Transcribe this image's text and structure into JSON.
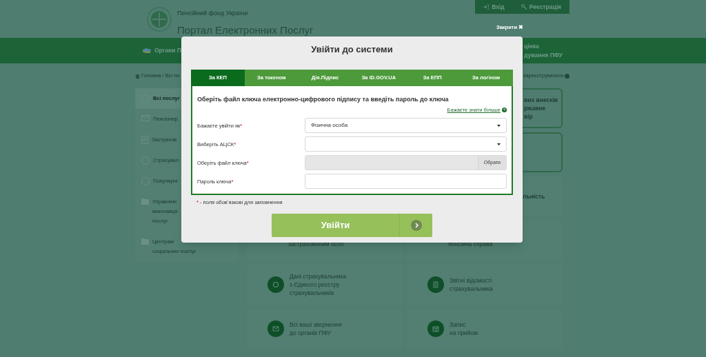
{
  "header": {
    "org": "Пенсійний фонд України",
    "title": "Портал Електронних Послуг",
    "buttons": [
      {
        "label": "Вхід",
        "kind": "login"
      },
      {
        "label": "Реєстрація",
        "kind": "register"
      }
    ]
  },
  "close_label": "Закрити ✖",
  "nav": {
    "left": "Органи П",
    "right": [
      "цінка",
      "дування ПФУ"
    ]
  },
  "breadcrumb": "Головна / Всі по",
  "help_link": "зареєструватися",
  "sidebar": [
    {
      "lines": [
        "Всі послуг"
      ],
      "kind": "circle",
      "selected": true
    },
    {
      "lines": [
        "Пенсіонер"
      ],
      "kind": "mail",
      "selected": false
    },
    {
      "lines": [
        "Застрахов"
      ],
      "kind": "doc",
      "selected": false
    },
    {
      "lines": [
        "Страхувал"
      ],
      "kind": "circle",
      "selected": false
    },
    {
      "lines": [
        "Популярні"
      ],
      "kind": "circle",
      "selected": false
    },
    {
      "lines": [
        "Управлінн",
        "виконавця",
        "послуг"
      ],
      "kind": "folder",
      "selected": false
    },
    {
      "lines": [
        "Центрам",
        "соціальних послуг"
      ],
      "kind": "folder",
      "selected": false
    }
  ],
  "side_cards": [
    {
      "lines": [
        "вих внесків",
        "ржавне",
        "вір"
      ],
      "outlined": true
    },
    {
      "outlined": true
    },
    {
      "lines": [
        "льність"
      ],
      "outlined": false
    }
  ],
  "services": [
    {
      "lines": [
        "застрахованим особ"
      ],
      "kind": "partial"
    },
    {
      "lines": [
        "пенсійна справа"
      ],
      "kind": "partial"
    },
    {
      "lines": [
        "Дані страхувальника",
        "з Єдиного реєстру",
        "страхувальників"
      ],
      "kind": "chat"
    },
    {
      "lines": [
        "Звітні відомості",
        "страхувальника"
      ],
      "kind": "doc"
    },
    {
      "lines": [
        "Всі ваші звернення",
        "до органів ПФУ"
      ],
      "kind": "mail"
    },
    {
      "lines": [
        "Запис",
        "на прийом"
      ],
      "kind": "calendar"
    }
  ],
  "modal": {
    "title": "Увійти до системи",
    "tabs": [
      {
        "label": "За КЕП",
        "selected": true
      },
      {
        "label": "За токеном",
        "selected": false
      },
      {
        "label": "Дія.Підпис",
        "selected": false
      },
      {
        "label": "За ID.GOV.UA",
        "selected": false
      },
      {
        "label": "За ЕПП",
        "selected": false
      },
      {
        "label": "За логіном",
        "selected": false
      }
    ],
    "heading": "Оберіть файл ключа електронно-цифрового підпису та введіть пароль до ключа",
    "more_link": "Бажаєте знати більше",
    "fields": [
      {
        "label": "Бажаєте увійти як",
        "required_mark": "*",
        "kind": "select",
        "value": "Фізична особа"
      },
      {
        "label": "Виберіть АЦСК",
        "required_mark": "*",
        "kind": "select"
      },
      {
        "label": "Оберіть файл ключа",
        "required_mark": "*",
        "kind": "file",
        "button": "Обрати"
      },
      {
        "label": "Пароль ключа",
        "required_mark": "*",
        "kind": "password"
      }
    ],
    "note_mark": "*",
    "note": "- поля обовʼязкові для заповнення",
    "submit": "Увійти"
  }
}
